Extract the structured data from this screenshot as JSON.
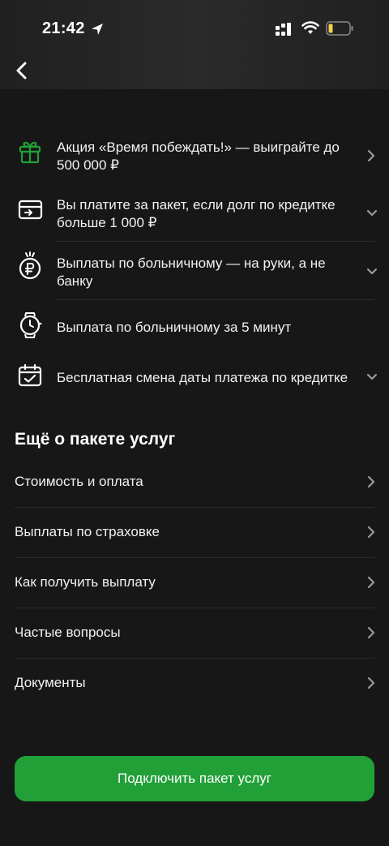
{
  "status": {
    "time": "21:42"
  },
  "features": [
    {
      "icon": "gift-icon",
      "text": "Акция «Время побеждать!» — выиграйте до 500 000 ₽",
      "action": "chevron-right"
    },
    {
      "icon": "card-transfer-icon",
      "text": "Вы платите за пакет, если долг по кредитке больше 1 000 ₽",
      "action": "chevron-down"
    },
    {
      "icon": "ruble-coin-icon",
      "text": "Выплаты по больничному — на руки, а не банку",
      "action": "chevron-down"
    },
    {
      "icon": "stopwatch-icon",
      "text": "Выплата по больничному за 5 минут",
      "action": ""
    },
    {
      "icon": "calendar-check-icon",
      "text": "Бесплатная смена даты платежа по кредитке",
      "action": "chevron-down"
    }
  ],
  "section": {
    "title": "Ещё о пакете услуг"
  },
  "menu": [
    {
      "label": "Стоимость и оплата"
    },
    {
      "label": "Выплаты по страховке"
    },
    {
      "label": "Как получить выплату"
    },
    {
      "label": "Частые вопросы"
    },
    {
      "label": "Документы"
    }
  ],
  "cta": {
    "label": "Подключить пакет услуг"
  },
  "colors": {
    "accent": "#21a038",
    "background": "#171717",
    "text": "#ffffff"
  }
}
